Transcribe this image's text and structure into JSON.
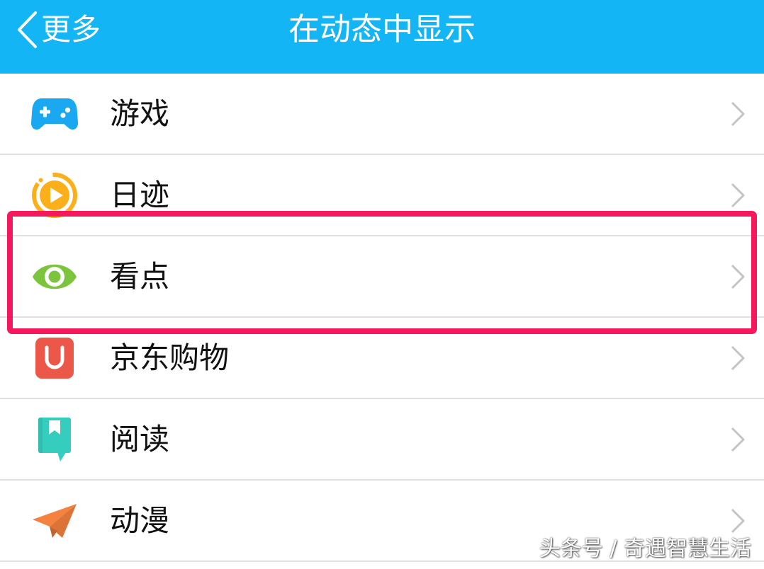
{
  "colors": {
    "header_bg": "#13B5F5",
    "highlight_border": "#F6185C",
    "separator": "#E0E0E0",
    "chevron": "#C4C4C4"
  },
  "header": {
    "back_icon": "chevron-left-icon",
    "back_label": "更多",
    "title": "在动态中显示"
  },
  "items": [
    {
      "label": "游戏",
      "icon": "game-controller-icon",
      "icon_color": "#1AA8F0"
    },
    {
      "label": "日迹",
      "icon": "play-circle-icon",
      "icon_color": "#FBB01B"
    },
    {
      "label": "看点",
      "icon": "eye-icon",
      "icon_color": "#7CC43C",
      "highlighted": true
    },
    {
      "label": "京东购物",
      "icon": "shopping-bag-u-icon",
      "icon_color": "#EB5748"
    },
    {
      "label": "阅读",
      "icon": "book-bookmark-icon",
      "icon_color": "#35CDBE"
    },
    {
      "label": "动漫",
      "icon": "paper-plane-icon",
      "icon_color": "#F5823F"
    }
  ],
  "row_chevron_icon": "chevron-right-icon",
  "watermark": "头条号 / 奇遇智慧生活"
}
